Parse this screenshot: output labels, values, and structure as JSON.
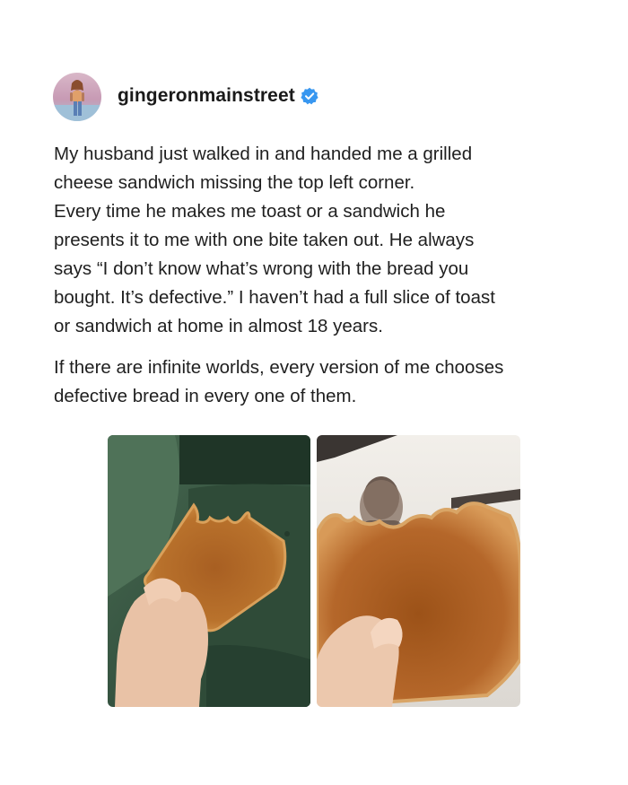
{
  "post": {
    "username": "gingeronmainstreet",
    "verified": true,
    "avatar_icon": "profile-photo",
    "verified_icon": "verified-badge-icon",
    "paragraphs": [
      "My husband just walked in and handed me a grilled\ncheese sandwich missing the top left corner.\nEvery time he makes me toast or a sandwich he\npresents it to me with one bite taken out. He always\nsays “I don’t know what’s wrong with the bread you\nbought. It’s defective.” I haven’t had a full slice of toast\nor sandwich at home in almost 18 years.",
      "If there are infinite worlds, every version of me chooses\ndefective bread in every one of them."
    ],
    "photos": [
      {
        "subject": "hand holding bitten grilled cheese sandwich in front of green couch"
      },
      {
        "subject": "hand holding bitten grilled cheese sandwich with blurred man in background"
      }
    ],
    "colors": {
      "verified_blue": "#3897f0",
      "text": "#1f1f1f",
      "couch_green": "#3c5a44",
      "toast": "#b9722c"
    }
  }
}
